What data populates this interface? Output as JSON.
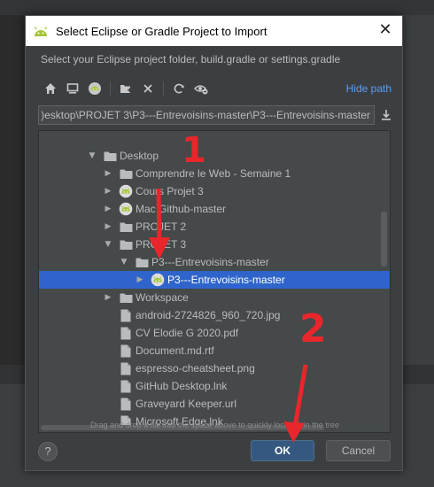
{
  "dialog": {
    "title": "Select Eclipse or Gradle Project to Import",
    "close_glyph": "✕",
    "instruction": "Select your Eclipse project folder, build.gradle or settings.gradle",
    "toolbar": {
      "icons": [
        "home-icon",
        "desktop-icon",
        "android-project-icon",
        "new-folder-icon",
        "delete-icon",
        "refresh-icon",
        "show-hidden-icon"
      ],
      "hide_path_label": "Hide path"
    },
    "path_value": ")esktop\\PROJET 3\\P3---Entrevoisins-master\\P3---Entrevoisins-master",
    "tree": [
      {
        "label": "Desktop",
        "arrow": "▼",
        "icon": "folder",
        "indent": 0
      },
      {
        "label": "Comprendre le Web - Semaine 1",
        "arrow": "▶",
        "icon": "folder",
        "indent": 1
      },
      {
        "label": "Cours Projet 3",
        "arrow": "▶",
        "icon": "android",
        "indent": 1
      },
      {
        "label": "Mac Github-master",
        "arrow": "▶",
        "icon": "android",
        "indent": 1
      },
      {
        "label": "PROJET 2",
        "arrow": "▶",
        "icon": "folder",
        "indent": 1
      },
      {
        "label": "PROJET 3",
        "arrow": "▼",
        "icon": "folder",
        "indent": 1
      },
      {
        "label": "P3---Entrevoisins-master",
        "arrow": "▼",
        "icon": "folder",
        "indent": 2
      },
      {
        "label": "P3---Entrevoisins-master",
        "arrow": "▶",
        "icon": "android",
        "indent": 3,
        "selected": true
      },
      {
        "label": "Workspace",
        "arrow": "▶",
        "icon": "folder",
        "indent": 1
      },
      {
        "label": "android-2724826_960_720.jpg",
        "arrow": "",
        "icon": "file",
        "indent": 1
      },
      {
        "label": "CV Elodie G 2020.pdf",
        "arrow": "",
        "icon": "file",
        "indent": 1
      },
      {
        "label": "Document.md.rtf",
        "arrow": "",
        "icon": "file",
        "indent": 1
      },
      {
        "label": "espresso-cheatsheet.png",
        "arrow": "",
        "icon": "file",
        "indent": 1
      },
      {
        "label": "GitHub Desktop.lnk",
        "arrow": "",
        "icon": "file",
        "indent": 1
      },
      {
        "label": "Graveyard Keeper.url",
        "arrow": "",
        "icon": "file",
        "indent": 1
      },
      {
        "label": "Microsoft Edge.lnk",
        "arrow": "",
        "icon": "file",
        "indent": 1
      }
    ],
    "hint": "Drag and drop a file into the space above to quickly locate it in the tree",
    "help_label": "?",
    "ok_label": "OK",
    "cancel_label": "Cancel"
  },
  "annotations": {
    "step1": "1",
    "step2": "2",
    "color": "#e8262b"
  },
  "colors": {
    "selection": "#2f65ca",
    "link": "#589df6",
    "ok_button": "#365880",
    "android_green": "#a4c639"
  }
}
